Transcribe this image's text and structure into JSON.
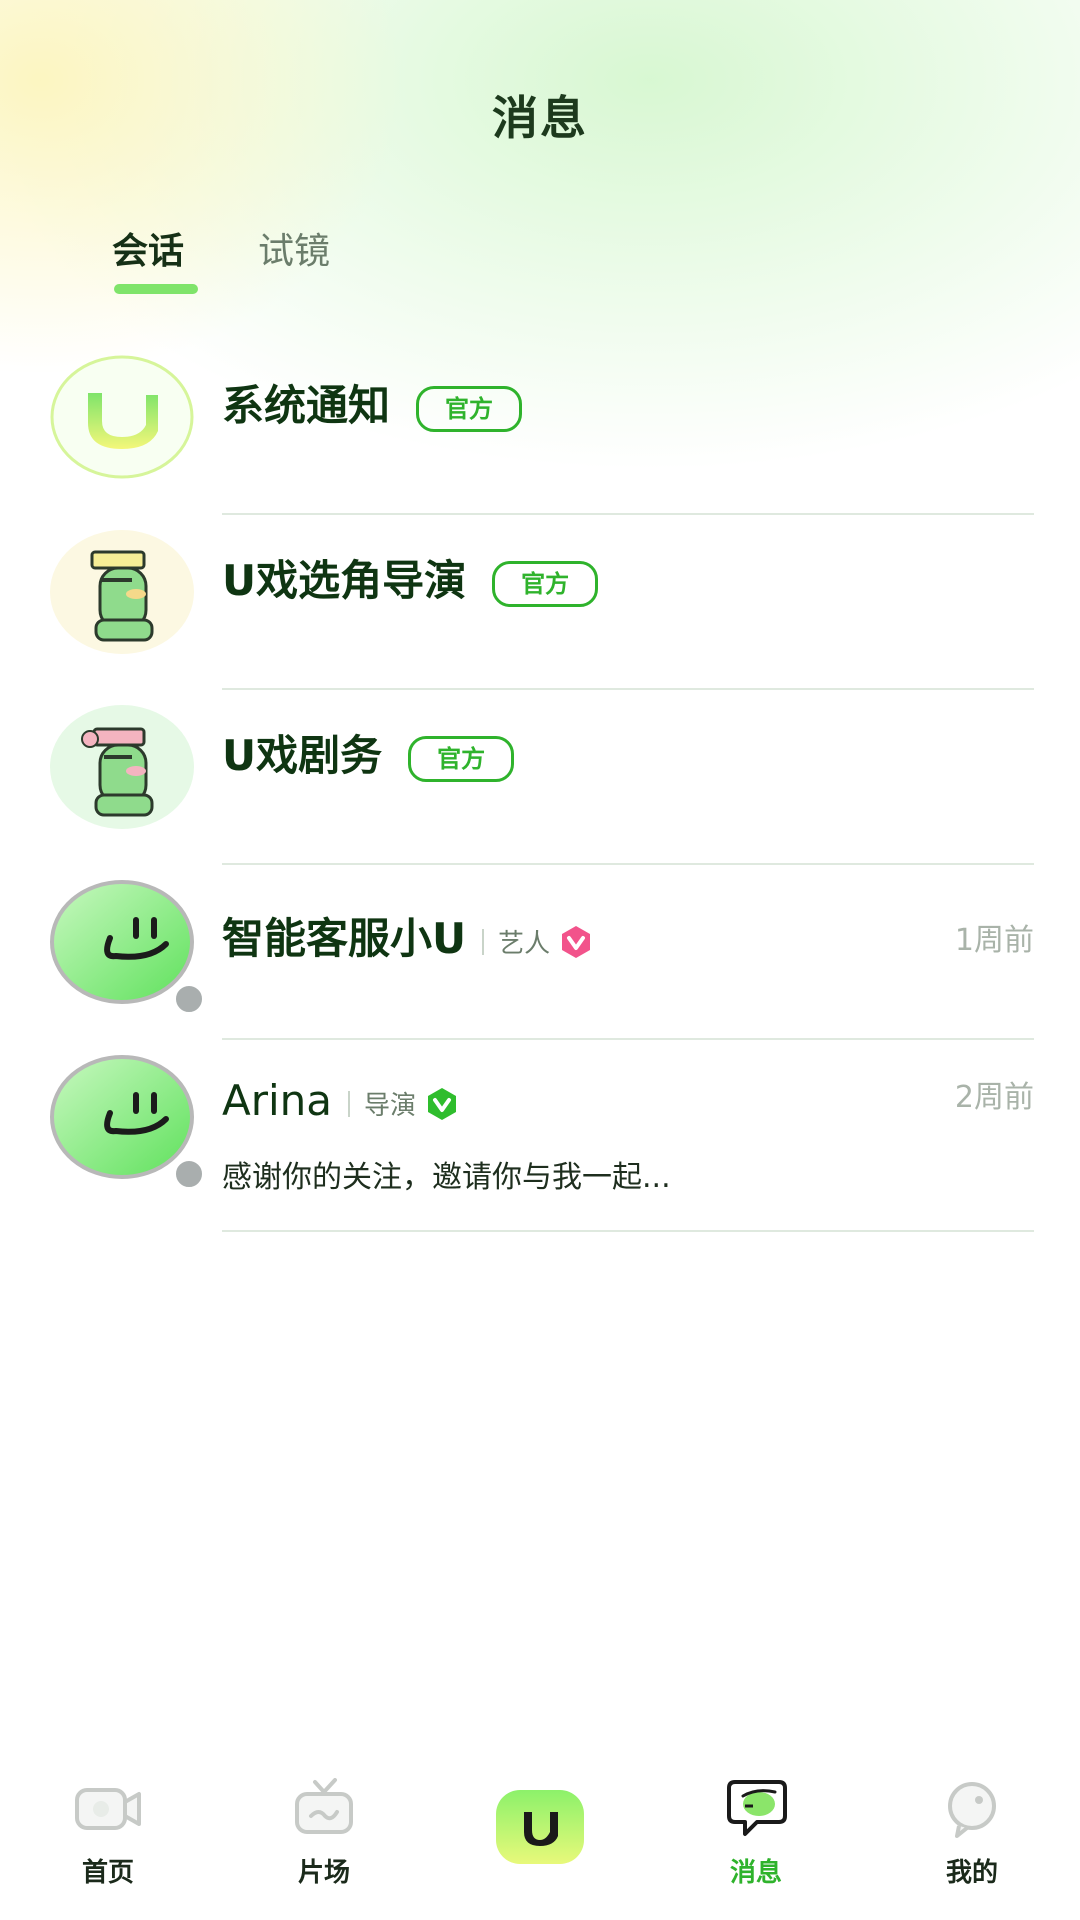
{
  "header": {
    "title": "消息"
  },
  "tabs": [
    {
      "label": "会话",
      "active": true
    },
    {
      "label": "试镜",
      "active": false
    }
  ],
  "conversations": [
    {
      "name": "系统通知",
      "badge": "官方",
      "avatar": "u-logo-avatar"
    },
    {
      "name": "U戏选角导演",
      "badge": "官方",
      "avatar": "director-character-avatar"
    },
    {
      "name": "U戏剧务",
      "badge": "官方",
      "avatar": "crew-character-avatar"
    },
    {
      "name": "智能客服小U",
      "role": "艺人",
      "verify_color": "#f2538b",
      "time": "1周前",
      "avatar": "smiley-avatar"
    },
    {
      "name": "Arina",
      "role": "导演",
      "verify_color": "#2fbd2d",
      "time": "2周前",
      "preview": "感谢你的关注，邀请你与我一起...",
      "avatar": "smiley-avatar"
    }
  ],
  "tabbar": [
    {
      "label": "首页",
      "icon": "camera-icon"
    },
    {
      "label": "片场",
      "icon": "tv-icon"
    },
    {
      "label": "",
      "icon": "u-logo-icon"
    },
    {
      "label": "消息",
      "icon": "message-icon",
      "active": true
    },
    {
      "label": "我的",
      "icon": "profile-icon"
    }
  ],
  "colors": {
    "accent": "#2fb32c",
    "underline": "#7fe46a",
    "title": "#1d3a1d"
  }
}
